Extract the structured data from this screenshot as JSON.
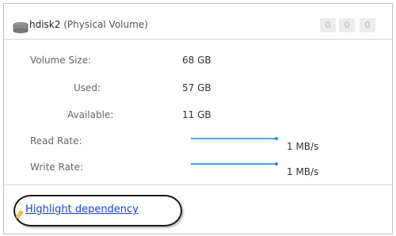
{
  "header": {
    "icon": "disk-icon",
    "name": "hdisk2",
    "type": "(Physical Volume)",
    "counters": [
      "0",
      "0",
      "0"
    ]
  },
  "stats": {
    "volume_size": {
      "label": "Volume Size:",
      "value": "68 GB"
    },
    "used": {
      "label": "Used:",
      "value": "57 GB"
    },
    "available": {
      "label": "Available:",
      "value": "11 GB"
    },
    "read_rate": {
      "label": "Read Rate:",
      "value": "1 MB/s"
    },
    "write_rate": {
      "label": "Write Rate:",
      "value": "1 MB/s"
    }
  },
  "footer": {
    "link_icon": "highlighter-icon",
    "link_label": "Highlight dependency"
  },
  "colors": {
    "link": "#1a3fd1",
    "rate_line": "#4aa3e0",
    "annotation_ring": "#1a1a1a"
  }
}
